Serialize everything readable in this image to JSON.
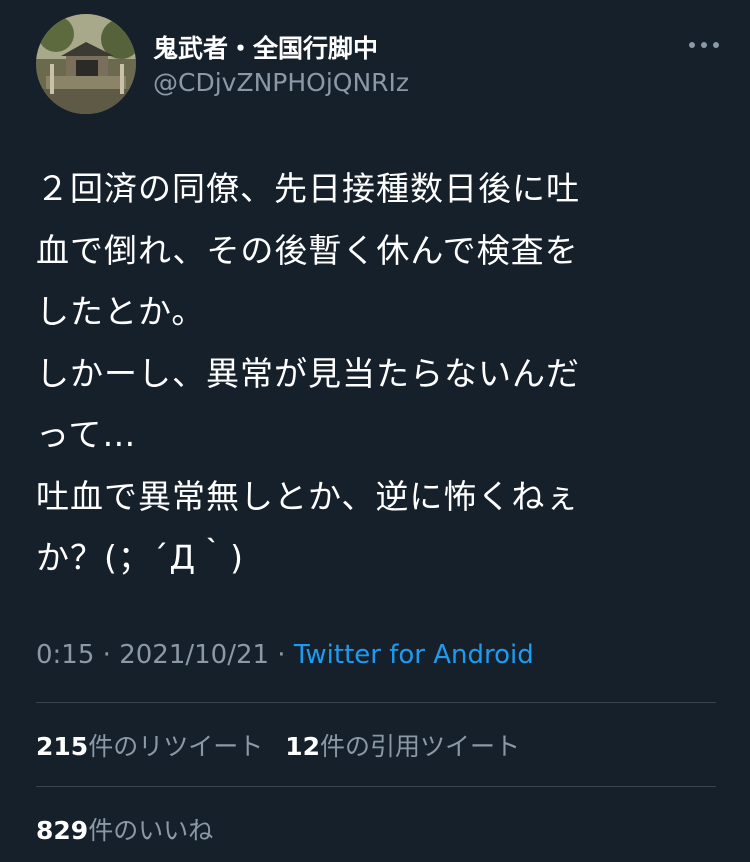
{
  "user": {
    "display_name": "鬼武者・全国行脚中",
    "handle": "@CDjvZNPHOjQNRIz",
    "avatar_desc": "shrine-photo"
  },
  "tweet": {
    "lines": [
      "２回済の同僚、先日接種数日後に吐",
      "血で倒れ、その後暫く休んで検査を",
      "したとか。",
      "しかーし、異常が見当たらないんだ",
      "って…",
      "吐血で異常無しとか、逆に怖くねぇ",
      "か？(；´Д｀)"
    ]
  },
  "meta": {
    "time": "0:15",
    "separator1": " · ",
    "date": "2021/10/21",
    "separator2": " · ",
    "source": "Twitter for Android"
  },
  "stats": {
    "retweets_count": "215",
    "retweets_label": "件のリツイート",
    "quotes_count": "12",
    "quotes_label": "件の引用ツイート",
    "likes_count": "829",
    "likes_label": "件のいいね"
  },
  "colors": {
    "background": "#15202b",
    "text": "#ffffff",
    "secondary": "#8b98a5",
    "link": "#1d9bf0",
    "divider": "#38444d"
  },
  "icons": {
    "more": "more-horizontal-icon"
  }
}
